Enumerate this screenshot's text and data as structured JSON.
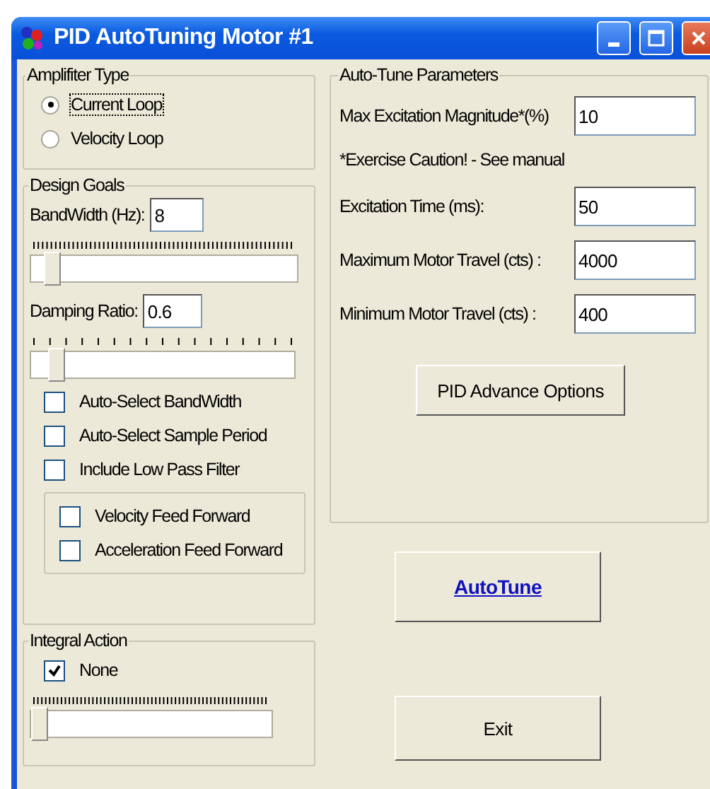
{
  "window": {
    "title": "PID AutoTuning Motor #1"
  },
  "amplifier_type": {
    "label": "Amplifiter Type",
    "options": [
      {
        "label": "Current Loop",
        "selected": true
      },
      {
        "label": "Velocity Loop",
        "selected": false
      }
    ]
  },
  "design_goals": {
    "label": "Design Goals",
    "bandwidth": {
      "label": "BandWidth (Hz):",
      "value": "8",
      "level": 0.05
    },
    "damping": {
      "label": "Damping Ratio:",
      "value": "0.6",
      "level": 0.07
    },
    "checkboxes": [
      {
        "label": "Auto-Select BandWidth",
        "checked": false
      },
      {
        "label": "Auto-Select Sample Period",
        "checked": false
      },
      {
        "label": "Include Low Pass Filter",
        "checked": false
      }
    ],
    "feed_forward": [
      {
        "label": "Velocity Feed Forward",
        "checked": false
      },
      {
        "label": "Acceleration Feed Forward",
        "checked": false
      }
    ]
  },
  "integral_action": {
    "label": "Integral Action",
    "checkbox": {
      "label": "None",
      "checked": true
    },
    "slider": {
      "level": 0
    }
  },
  "auto_tune_parameters": {
    "label": "Auto-Tune Parameters",
    "items": [
      {
        "kind": "field",
        "label": "Max Excitation Magnitude*(%)",
        "value": "10"
      },
      {
        "kind": "note",
        "text": "*Exercise Caution! - See manual"
      },
      {
        "kind": "field",
        "label": "Excitation Time (ms):",
        "value": "50"
      },
      {
        "kind": "field",
        "label": "Maximum Motor Travel (cts) :",
        "value": "4000"
      },
      {
        "kind": "field",
        "label": "Minimum Motor Travel (cts) :",
        "value": "400"
      }
    ],
    "button": "PID Advance Options"
  },
  "buttons": [
    {
      "label": "AutoTune",
      "kind": "primary"
    },
    {
      "label": "Exit",
      "kind": "normal"
    }
  ]
}
